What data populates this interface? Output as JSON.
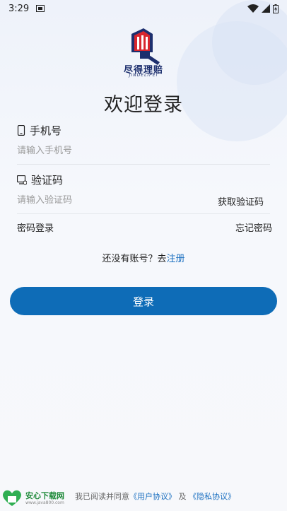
{
  "status_bar": {
    "time": "3:29"
  },
  "logo": {
    "name": "尽得理赔",
    "sub": "JINDELIPEI"
  },
  "title": "欢迎登录",
  "phone": {
    "label": "手机号",
    "placeholder": "请输入手机号"
  },
  "code": {
    "label": "验证码",
    "placeholder": "请输入验证码",
    "get_code": "获取验证码"
  },
  "links": {
    "password_login": "密码登录",
    "forgot_password": "忘记密码"
  },
  "register": {
    "prompt": "还没有账号？去",
    "link": "注册"
  },
  "login_button": "登录",
  "agreement": {
    "prefix": "我已阅读并同意",
    "user_agreement": "《用户协议》",
    "and": "及",
    "privacy": "《隐私协议》"
  },
  "watermark": {
    "title": "安心下载网",
    "url": "www.java800.com"
  },
  "colors": {
    "accent": "#0e6cb7",
    "link": "#1a6fc0",
    "logo_red": "#d8262e",
    "logo_navy": "#1d2f6e"
  }
}
